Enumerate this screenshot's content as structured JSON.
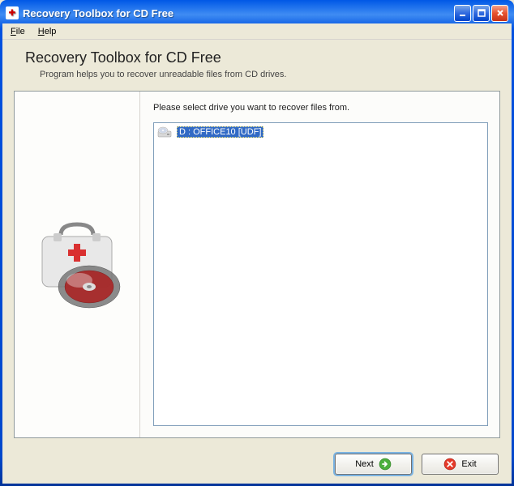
{
  "window": {
    "title": "Recovery Toolbox for CD Free"
  },
  "menu": {
    "file": "File",
    "help": "Help"
  },
  "header": {
    "title": "Recovery Toolbox for CD Free",
    "subtitle": "Program helps you to recover unreadable files from CD drives."
  },
  "main": {
    "instruction": "Please select drive you want to recover files from.",
    "drives": [
      {
        "label": "D : OFFICE10 [UDF]",
        "selected": true
      }
    ]
  },
  "footer": {
    "next_label": "Next",
    "exit_label": "Exit"
  }
}
